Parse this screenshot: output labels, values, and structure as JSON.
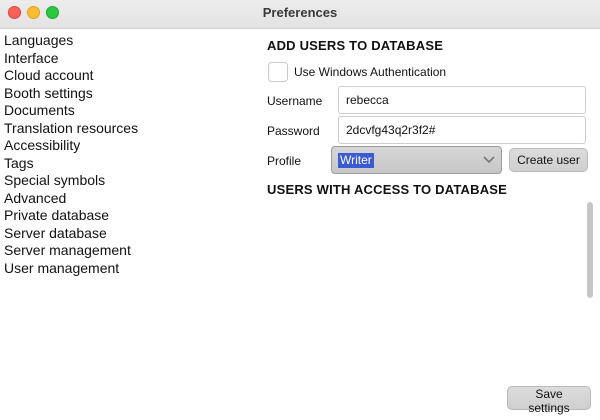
{
  "window": {
    "title": "Preferences"
  },
  "sidebar": {
    "items": [
      {
        "label": "Languages"
      },
      {
        "label": "Interface"
      },
      {
        "label": "Cloud account"
      },
      {
        "label": "Booth settings"
      },
      {
        "label": "Documents"
      },
      {
        "label": "Translation resources"
      },
      {
        "label": "Accessibility"
      },
      {
        "label": "Tags"
      },
      {
        "label": "Special symbols"
      },
      {
        "label": "Advanced"
      },
      {
        "label": "Private database"
      },
      {
        "label": "Server database"
      },
      {
        "label": "Server management"
      },
      {
        "label": "User management"
      }
    ]
  },
  "add_users": {
    "heading": "ADD USERS TO DATABASE",
    "windows_auth_label": "Use Windows Authentication",
    "windows_auth_checked": false,
    "username_label": "Username",
    "username_value": "rebecca",
    "password_label": "Password",
    "password_value": "2dcvfg43q2r3f2#",
    "profile_label": "Profile",
    "profile_selected": "Writer",
    "create_button": "Create user"
  },
  "users_with_access": {
    "heading": "USERS WITH ACCESS TO DATABASE"
  },
  "footer": {
    "save_button": "Save settings"
  },
  "colors": {
    "close": "#fe5f57",
    "minimize": "#febc2e",
    "maximize": "#28c840",
    "selection": "#3b5bd6"
  }
}
